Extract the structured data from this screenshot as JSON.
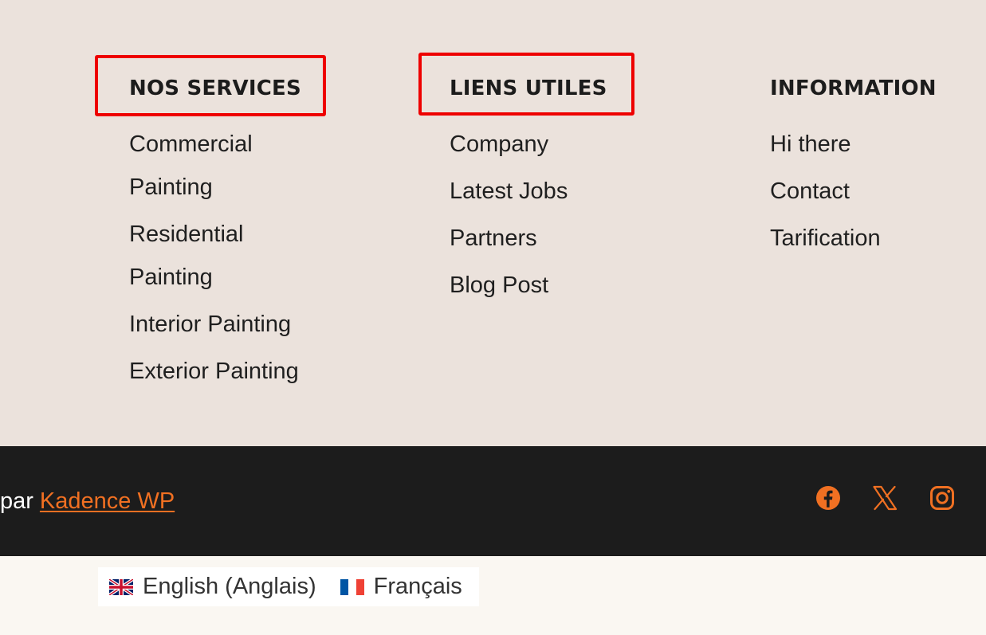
{
  "columns": [
    {
      "heading": "NOS SERVICES",
      "links": [
        "Commercial Painting",
        "Residential Painting",
        "Interior Painting",
        "Exterior Painting"
      ]
    },
    {
      "heading": "LIENS UTILES",
      "links": [
        "Company",
        "Latest Jobs",
        "Partners",
        "Blog Post"
      ]
    },
    {
      "heading": "INFORMATION",
      "links": [
        "Hi there",
        "Contact",
        "Tarification"
      ]
    }
  ],
  "footer": {
    "credit_prefix": "par",
    "credit_link": "Kadence WP",
    "social": [
      {
        "name": "facebook-icon"
      },
      {
        "name": "x-twitter-icon"
      },
      {
        "name": "instagram-icon"
      }
    ]
  },
  "languages": [
    {
      "label": "English (Anglais)",
      "flag": "uk-flag-icon"
    },
    {
      "label": "Français",
      "flag": "france-flag-icon"
    }
  ],
  "colors": {
    "footer_top_bg": "#ebe2dc",
    "footer_bottom_bg": "#1c1c1c",
    "accent": "#f07022",
    "highlight": "#ee0000"
  }
}
